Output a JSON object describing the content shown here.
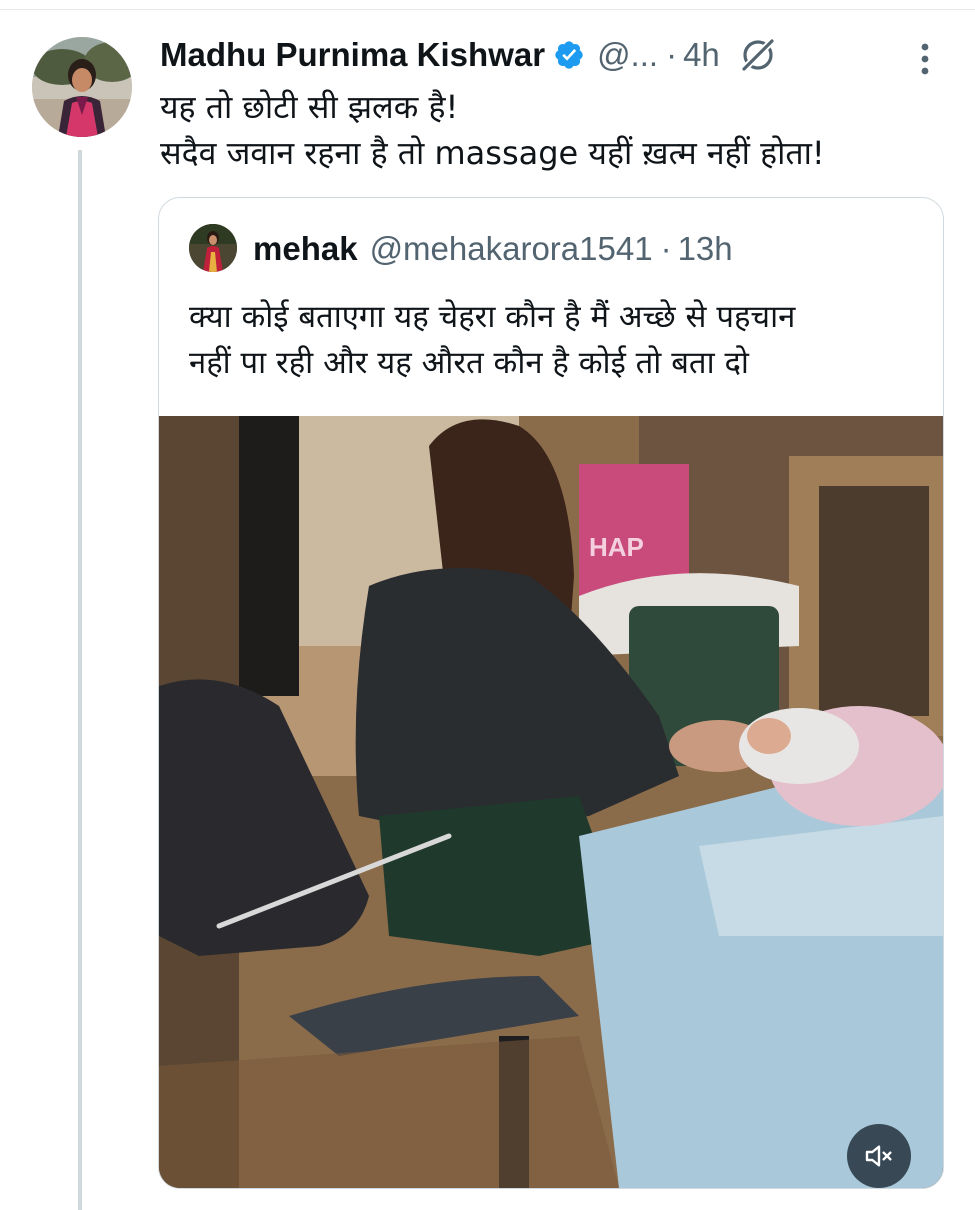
{
  "tweet": {
    "author_name": "Madhu Purnima Kishwar",
    "handle": "@...",
    "separator": "·",
    "time": "4h",
    "text_lines": [
      "यह तो छोटी सी झलक है!",
      "सदैव जवान रहना है तो  massage यहीं ख़त्म नहीं होता!"
    ]
  },
  "quoted_tweet": {
    "author_name": "mehak",
    "handle": "@mehakarora1541",
    "separator": "·",
    "time": "13h",
    "text_lines": [
      "क्या कोई बताएगा यह चेहरा कौन है मैं अच्छे से पहचान",
      "नहीं पा रही और यह औरत कौन है कोई तो बता दो"
    ],
    "media_type": "video",
    "media_overlay_text": "HAP"
  },
  "icons": {
    "verified": "verified-badge-icon",
    "grok": "grok-icon",
    "more": "more-vertical-icon",
    "mute": "speaker-muted-icon"
  },
  "colors": {
    "text_primary": "#0f1419",
    "text_secondary": "#536471",
    "verified_blue": "#1d9bf0",
    "border": "#cfd9de"
  }
}
